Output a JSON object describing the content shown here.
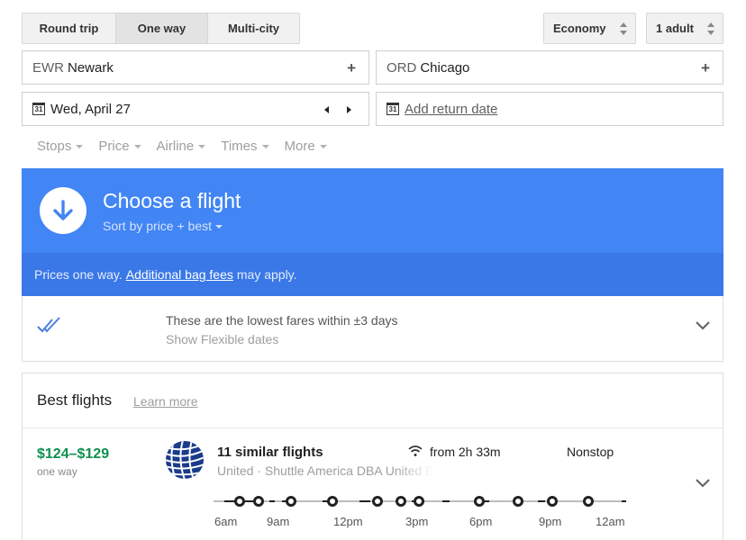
{
  "trip_type": {
    "tabs": [
      "Round trip",
      "One way",
      "Multi-city"
    ],
    "active": "One way"
  },
  "cabin": {
    "selected": "Economy"
  },
  "passengers": {
    "selected": "1 adult"
  },
  "origin": {
    "code": "EWR",
    "city": "Newark",
    "add": "+"
  },
  "destination": {
    "code": "ORD",
    "city": "Chicago",
    "add": "+"
  },
  "depart_date": {
    "calendar_day": "31",
    "value": "Wed, April 27"
  },
  "return_date": {
    "calendar_day": "31",
    "placeholder": "Add return date"
  },
  "filters": [
    "Stops",
    "Price",
    "Airline",
    "Times",
    "More"
  ],
  "banner": {
    "title": "Choose a flight",
    "sort": "Sort by price + best",
    "note_prefix": "Prices one way.",
    "note_link": "Additional bag fees",
    "note_suffix": "may apply."
  },
  "flexible": {
    "line1": "These are the lowest fares within ±3 days",
    "line2": "Show Flexible dates"
  },
  "best_flights": {
    "title": "Best flights",
    "learn_more": "Learn more",
    "result": {
      "price": "$124–$129",
      "price_note": "one way",
      "count": "11 similar flights",
      "airlines": "United · Shuttle America DBA United Express",
      "duration": "from 2h 33m",
      "stops": "Nonstop",
      "time_labels": [
        "6am",
        "9am",
        "12pm",
        "3pm",
        "6pm",
        "9pm",
        "12am"
      ]
    }
  },
  "colors": {
    "accent_blue": "#4285f4",
    "accent_blue_dark": "#3b78e7",
    "price_green": "#0d904f"
  },
  "icons": {
    "banner": "arrow-down-circle-icon",
    "flexible": "double-check-icon",
    "expand": "chevron-down-icon",
    "wifi": "wifi-icon",
    "calendar": "calendar-icon",
    "airline": "united-globe-logo"
  }
}
